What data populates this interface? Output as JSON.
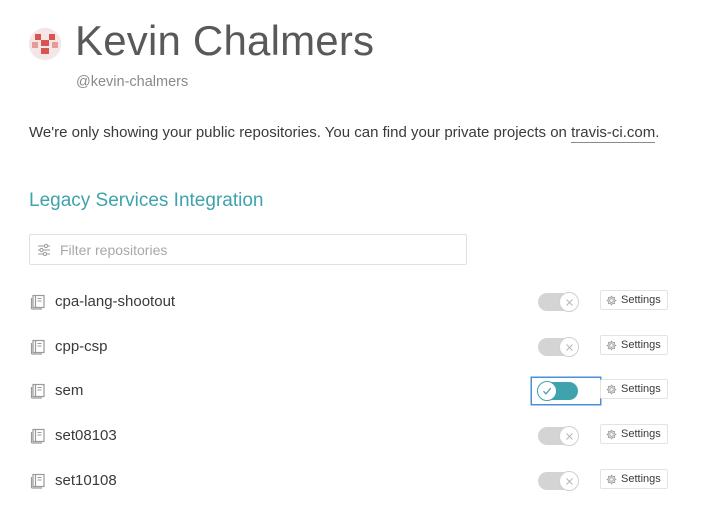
{
  "profile": {
    "name": "Kevin Chalmers",
    "handle": "@kevin-chalmers",
    "avatar_icon": "identicon-avatar",
    "avatar_color": "#d9534f"
  },
  "notice": {
    "text": "We're only showing your public repositories. You can find your private projects on ",
    "link_text": "travis-ci.com",
    "suffix": "."
  },
  "section": {
    "title": "Legacy Services Integration"
  },
  "filter": {
    "placeholder": "Filter repositories",
    "value": "",
    "icon": "sliders-icon"
  },
  "repositories": [
    {
      "name": "cpa-lang-shootout",
      "enabled": false,
      "settings_label": "Settings"
    },
    {
      "name": "cpp-csp",
      "enabled": false,
      "settings_label": "Settings"
    },
    {
      "name": "sem",
      "enabled": true,
      "settings_label": "Settings"
    },
    {
      "name": "set08103",
      "enabled": false,
      "settings_label": "Settings"
    },
    {
      "name": "set10108",
      "enabled": false,
      "settings_label": "Settings"
    }
  ],
  "colors": {
    "accent": "#3ea3ad",
    "toggle_off": "#d4d4d4",
    "focus": "#4a90d9"
  }
}
